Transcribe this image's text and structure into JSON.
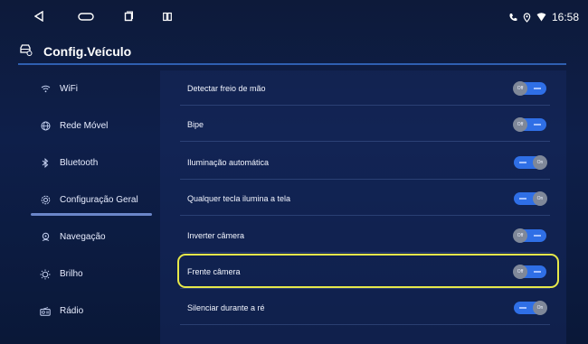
{
  "statusbar": {
    "time": "16:58",
    "icons": [
      "back-icon",
      "home-icon",
      "recents-icon",
      "split-screen-icon",
      "phone-icon",
      "location-icon",
      "wifi-signal-icon"
    ]
  },
  "header": {
    "title": "Config.Veículo",
    "icon": "car-settings-icon"
  },
  "sidebar": {
    "items": [
      {
        "label": "WiFi",
        "icon": "wifi-icon",
        "active": false
      },
      {
        "label": "Rede Móvel",
        "icon": "globe-icon",
        "active": false
      },
      {
        "label": "Bluetooth",
        "icon": "bluetooth-icon",
        "active": false
      },
      {
        "label": "Configuração Geral",
        "icon": "gear-icon",
        "active": true
      },
      {
        "label": "Navegação",
        "icon": "navigation-icon",
        "active": false
      },
      {
        "label": "Brilho",
        "icon": "sun-icon",
        "active": false
      },
      {
        "label": "Rádio",
        "icon": "radio-icon",
        "active": false
      }
    ]
  },
  "settings": {
    "rows": [
      {
        "label": "Detectar freio de mão",
        "state": "Off"
      },
      {
        "label": "Bipe",
        "state": "Off"
      },
      {
        "label": "Iluminação automática",
        "state": "On"
      },
      {
        "label": "Qualquer tecla ilumina a tela",
        "state": "On"
      },
      {
        "label": "Inverter câmera",
        "state": "Off"
      },
      {
        "label": "Frente câmera",
        "state": "Off",
        "highlighted": true
      },
      {
        "label": "Silenciar durante a ré",
        "state": "On"
      }
    ]
  },
  "colors": {
    "background": "#0e1f4a",
    "accent": "#2f6fe6",
    "highlight": "#e6e84a"
  }
}
